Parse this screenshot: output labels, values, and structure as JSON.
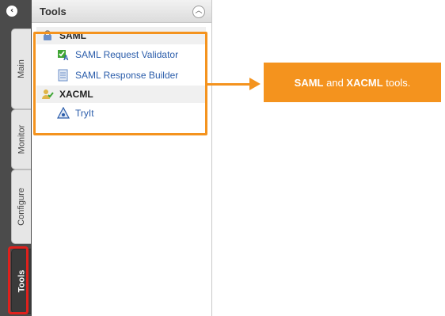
{
  "tabs": [
    {
      "label": "Main"
    },
    {
      "label": "Monitor"
    },
    {
      "label": "Configure"
    },
    {
      "label": "Tools"
    }
  ],
  "panel": {
    "title": "Tools",
    "groups": [
      {
        "label": "SAML",
        "icon": "lock-icon",
        "items": [
          {
            "label": "SAML Request Validator",
            "icon": "validator-icon"
          },
          {
            "label": "SAML Response Builder",
            "icon": "document-builder-icon"
          }
        ]
      },
      {
        "label": "XACML",
        "icon": "user-check-icon",
        "items": [
          {
            "label": "TryIt",
            "icon": "tryit-icon"
          }
        ]
      }
    ]
  },
  "callout": {
    "part1": "SAML",
    "part2": " and ",
    "part3": "XACML",
    "part4": " tools."
  },
  "colors": {
    "accent": "#f4931e",
    "highlight": "#e0201c",
    "link": "#2a5caa",
    "strip": "#4b4b4b"
  }
}
